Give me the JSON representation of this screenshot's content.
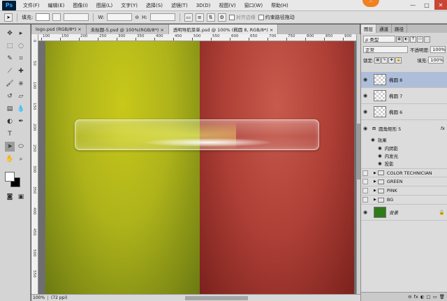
{
  "menubar": {
    "logo": "Ps",
    "items": [
      "文件(F)",
      "编辑(E)",
      "图像(I)",
      "图层(L)",
      "文字(Y)",
      "选择(S)",
      "滤镜(T)",
      "3D(D)",
      "视图(V)",
      "窗口(W)",
      "帮助(H)"
    ],
    "win_min": "—",
    "win_max": "□",
    "win_close": "✕"
  },
  "options": {
    "fill_label": "填充:",
    "w_label": "W:",
    "h_label": "H:",
    "align_edges": "对齐边缘",
    "constrain_path": "约束路径拖动"
  },
  "tabs": [
    {
      "label": "logo.psd (RGB/8*)  ×",
      "active": false
    },
    {
      "label": "未标题-5.psd @ 100%(RGB/8*)  ×",
      "active": false
    },
    {
      "label": "透明导航菜单.psd @ 100% (椭圆 8, RGB/8*)  ×",
      "active": true
    }
  ],
  "ruler": {
    "top": [
      "100",
      "150",
      "200",
      "250",
      "300",
      "350",
      "400",
      "450",
      "500",
      "550",
      "600",
      "650",
      "700",
      "750",
      "800",
      "850",
      "900"
    ],
    "left": [
      "0",
      "50",
      "100",
      "150",
      "200",
      "250",
      "300",
      "350",
      "400",
      "450",
      "500",
      "550"
    ]
  },
  "canvas_colors": {
    "left": "#b8bb18",
    "right": "#b5463b"
  },
  "status": {
    "zoom": "100%",
    "doc": "(72 ppi)"
  },
  "panel": {
    "tabs": [
      "图层",
      "通道",
      "路径"
    ],
    "filter_label": "ρ 类型",
    "blend_mode": "正常",
    "opacity_label": "不透明度:",
    "opacity_value": "100%",
    "lock_label": "锁定:",
    "fill_label": "填充:",
    "fill_value": "100%"
  },
  "layers": [
    {
      "name": "椭圆 8",
      "type": "shape",
      "selected": true
    },
    {
      "name": "椭圆 7",
      "type": "shape",
      "selected": false
    },
    {
      "name": "椭圆 6",
      "type": "shape",
      "selected": false
    },
    {
      "name": "圆角矩形 5",
      "type": "vector",
      "selected": false,
      "fx": "fx"
    },
    {
      "name": "COLOR TECHNICIAN",
      "type": "group"
    },
    {
      "name": "GREEN",
      "type": "group"
    },
    {
      "name": "PINK",
      "type": "group"
    },
    {
      "name": "BG",
      "type": "group"
    },
    {
      "name": "背景",
      "type": "background"
    }
  ],
  "effects": {
    "header": "效果",
    "items": [
      "内阴影",
      "内发光",
      "投影"
    ]
  },
  "panel_bottom": [
    "⊖",
    "fx",
    "◐",
    "□",
    "▭",
    "🗑"
  ]
}
